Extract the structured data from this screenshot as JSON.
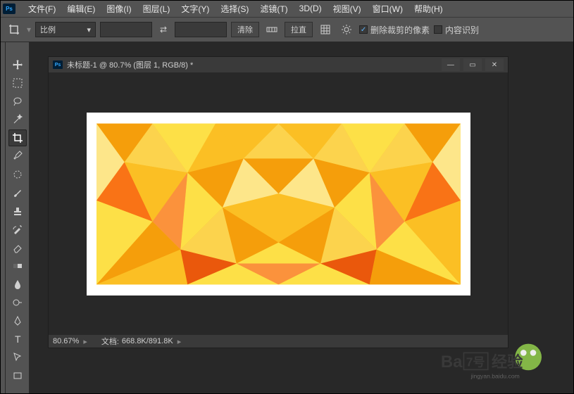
{
  "menubar": {
    "logo_text": "Ps",
    "items": [
      "文件(F)",
      "编辑(E)",
      "图像(I)",
      "图层(L)",
      "文字(Y)",
      "选择(S)",
      "滤镜(T)",
      "3D(D)",
      "视图(V)",
      "窗口(W)",
      "帮助(H)"
    ]
  },
  "optbar": {
    "ratio_dropdown": "比例",
    "clear_btn": "清除",
    "straighten_btn": "拉直",
    "delete_crop_label": "删除裁剪的像素",
    "delete_crop_checked": true,
    "content_aware_label": "内容识别",
    "content_aware_checked": false
  },
  "document": {
    "title": "未标题-1 @ 80.7% (图层 1, RGB/8) *",
    "zoom": "80.67%",
    "docinfo_label": "文档:",
    "docinfo_value": "668.8K/891.8K"
  },
  "watermark": {
    "brand_left": "Ba",
    "brand_frame": "7号",
    "brand_right": "经验",
    "sub": "jingyan.baidu.com"
  },
  "colors": {
    "bg": "#535353",
    "dark": "#282828",
    "accent": "#31a8ff"
  }
}
